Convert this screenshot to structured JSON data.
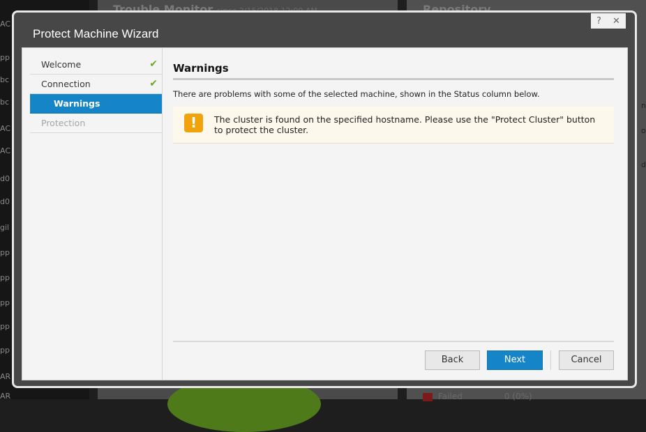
{
  "background": {
    "left_fragments": [
      "AC",
      "pp",
      "bc",
      "bc",
      "AC",
      "AC",
      "d0",
      "d0",
      "gil",
      "pp",
      "pp",
      "pp",
      "pp",
      "pp",
      "AR",
      "AR"
    ],
    "trouble_monitor_title": "Trouble Monitor",
    "trouble_monitor_since": "since 2/15/2018 12:00 AM",
    "repository_title": "Repository",
    "right_fragments": [
      "n",
      "o",
      "d"
    ],
    "legend_failed_label": "Failed",
    "legend_failed_value": "0 (0%)"
  },
  "dialog": {
    "title": "Protect Machine Wizard",
    "help_label": "?",
    "close_label": "✕"
  },
  "steps": [
    {
      "label": "Welcome",
      "state": "complete",
      "check": "✔"
    },
    {
      "label": "Connection",
      "state": "complete",
      "check": "✔"
    },
    {
      "label": "Warnings",
      "state": "active"
    },
    {
      "label": "Protection",
      "state": "disabled"
    }
  ],
  "content": {
    "heading": "Warnings",
    "description": "There are problems with some of the selected machine, shown in the Status column below.",
    "warning": {
      "icon": "warning-icon",
      "icon_glyph": "!",
      "message": "The cluster is found on the specified hostname. Please use the \"Protect Cluster\" button to protect the cluster."
    }
  },
  "buttons": {
    "back": "Back",
    "next": "Next",
    "cancel": "Cancel"
  },
  "colors": {
    "accent": "#1585c8",
    "warning": "#f0a30a",
    "check": "#6aaa2a"
  }
}
